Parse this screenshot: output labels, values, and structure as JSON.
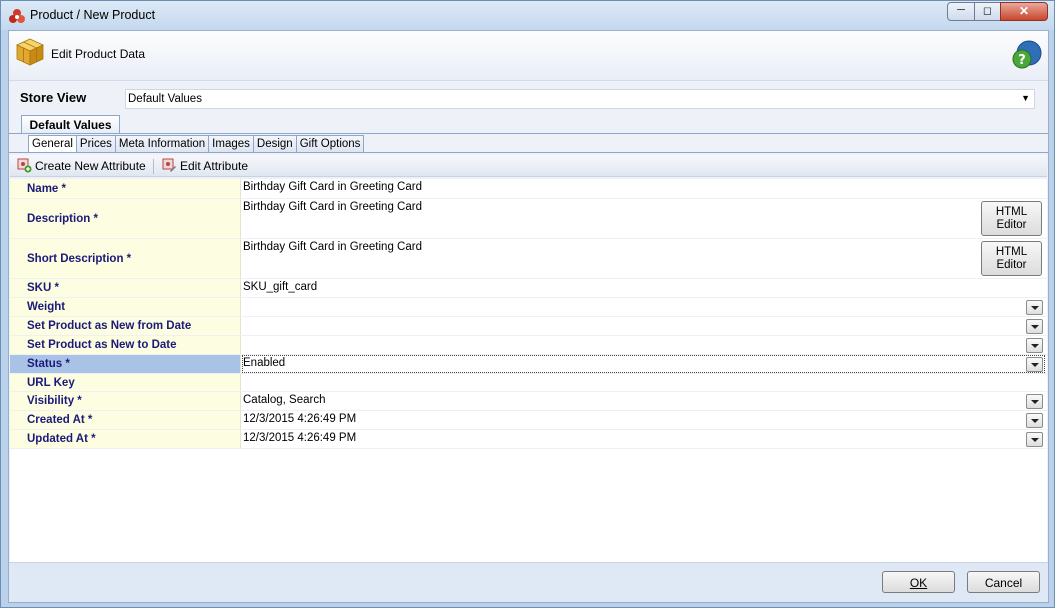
{
  "window": {
    "title": "Product / New Product"
  },
  "header": {
    "title": "Edit Product Data"
  },
  "store_view": {
    "label": "Store View",
    "value": "Default Values"
  },
  "scope_tab": {
    "label": "Default Values"
  },
  "tabs": [
    {
      "label": "General",
      "active": true
    },
    {
      "label": "Prices"
    },
    {
      "label": "Meta Information"
    },
    {
      "label": "Images"
    },
    {
      "label": "Design"
    },
    {
      "label": "Gift Options"
    }
  ],
  "toolbar": {
    "create_label": "Create New Attribute",
    "edit_label": "Edit Attribute"
  },
  "attributes": [
    {
      "label": "Name *",
      "value": "Birthday Gift Card in Greeting Card"
    },
    {
      "label": "Description *",
      "value": "Birthday Gift Card in Greeting Card",
      "button": "HTML Editor"
    },
    {
      "label": "Short Description *",
      "value": "Birthday Gift Card in Greeting Card",
      "button": "HTML Editor"
    },
    {
      "label": "SKU *",
      "value": "SKU_gift_card"
    },
    {
      "label": "Weight",
      "value": ""
    },
    {
      "label": "Set Product as New from Date",
      "value": ""
    },
    {
      "label": "Set Product as New to Date",
      "value": ""
    },
    {
      "label": "Status *",
      "value": "Enabled"
    },
    {
      "label": "URL Key",
      "value": ""
    },
    {
      "label": "Visibility *",
      "value": "Catalog, Search"
    },
    {
      "label": "Created At  *",
      "value": "12/3/2015 4:26:49 PM"
    },
    {
      "label": "Updated At  *",
      "value": "12/3/2015 4:26:49 PM"
    }
  ],
  "html_editor": {
    "line1": "HTML",
    "line2": "Editor"
  },
  "footer": {
    "ok": "OK",
    "cancel": "Cancel"
  }
}
